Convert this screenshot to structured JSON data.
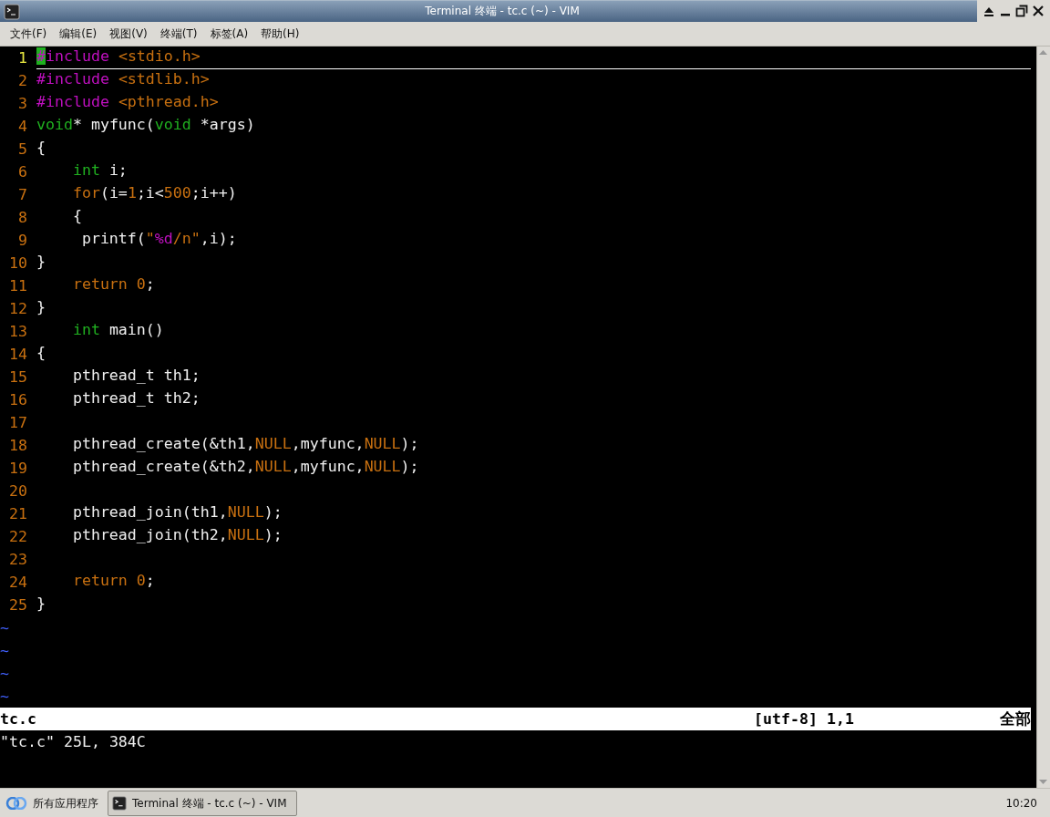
{
  "window": {
    "title": "Terminal 终端 - tc.c (~) - VIM"
  },
  "menu": [
    "文件(F)",
    "编辑(E)",
    "视图(V)",
    "终端(T)",
    "标签(A)",
    "帮助(H)"
  ],
  "editor": {
    "lines": [
      {
        "number": "1",
        "current": true,
        "tokens": [
          {
            "kind": "cursor",
            "text": "#"
          },
          {
            "kind": "preproc",
            "text": "include "
          },
          {
            "kind": "constant",
            "text": "<stdio.h>"
          }
        ]
      },
      {
        "number": "2",
        "current": false,
        "tokens": [
          {
            "kind": "preproc",
            "text": "#include "
          },
          {
            "kind": "constant",
            "text": "<stdlib.h>"
          }
        ]
      },
      {
        "number": "3",
        "current": false,
        "tokens": [
          {
            "kind": "preproc",
            "text": "#include "
          },
          {
            "kind": "constant",
            "text": "<pthread.h>"
          }
        ]
      },
      {
        "number": "4",
        "current": false,
        "tokens": [
          {
            "kind": "type",
            "text": "void"
          },
          {
            "kind": "plain",
            "text": "* myfunc("
          },
          {
            "kind": "type",
            "text": "void"
          },
          {
            "kind": "plain",
            "text": " *args)"
          }
        ]
      },
      {
        "number": "5",
        "current": false,
        "tokens": [
          {
            "kind": "plain",
            "text": "{"
          }
        ]
      },
      {
        "number": "6",
        "current": false,
        "indented": true,
        "tokens": [
          {
            "kind": "type",
            "text": "int"
          },
          {
            "kind": "plain",
            "text": " i;"
          }
        ]
      },
      {
        "number": "7",
        "current": false,
        "indented": true,
        "tokens": [
          {
            "kind": "constant",
            "text": "for"
          },
          {
            "kind": "plain",
            "text": "(i="
          },
          {
            "kind": "constant",
            "text": "1"
          },
          {
            "kind": "plain",
            "text": ";i<"
          },
          {
            "kind": "constant",
            "text": "500"
          },
          {
            "kind": "plain",
            "text": ";i++)"
          }
        ]
      },
      {
        "number": "8",
        "current": false,
        "indented": true,
        "tokens": [
          {
            "kind": "plain",
            "text": "{"
          }
        ]
      },
      {
        "number": "9",
        "current": false,
        "indented": true,
        "tokens": [
          {
            "kind": "plain",
            "text": " printf("
          },
          {
            "kind": "constant",
            "text": "\""
          },
          {
            "kind": "preproc",
            "text": "%d"
          },
          {
            "kind": "constant",
            "text": "/n\""
          },
          {
            "kind": "plain",
            "text": ",i);"
          }
        ]
      },
      {
        "number": "10",
        "current": false,
        "tokens": [
          {
            "kind": "plain",
            "text": "}"
          }
        ]
      },
      {
        "number": "11",
        "current": false,
        "indented": true,
        "tokens": [
          {
            "kind": "constant",
            "text": "return 0"
          },
          {
            "kind": "plain",
            "text": ";"
          }
        ]
      },
      {
        "number": "12",
        "current": false,
        "tokens": [
          {
            "kind": "plain",
            "text": "}"
          }
        ]
      },
      {
        "number": "13",
        "current": false,
        "indented": true,
        "tokens": [
          {
            "kind": "type",
            "text": "int"
          },
          {
            "kind": "plain",
            "text": " main()"
          }
        ]
      },
      {
        "number": "14",
        "current": false,
        "tokens": [
          {
            "kind": "plain",
            "text": "{"
          }
        ]
      },
      {
        "number": "15",
        "current": false,
        "indented": true,
        "tokens": [
          {
            "kind": "plain",
            "text": "pthread_t th1;"
          }
        ]
      },
      {
        "number": "16",
        "current": false,
        "indented": true,
        "tokens": [
          {
            "kind": "plain",
            "text": "pthread_t th2;"
          }
        ]
      },
      {
        "number": "17",
        "current": false
      },
      {
        "number": "18",
        "current": false,
        "indented": true,
        "tokens": [
          {
            "kind": "plain",
            "text": "pthread_create(&th1,"
          },
          {
            "kind": "constant",
            "text": "NULL"
          },
          {
            "kind": "plain",
            "text": ",myfunc,"
          },
          {
            "kind": "constant",
            "text": "NULL"
          },
          {
            "kind": "plain",
            "text": ");"
          }
        ]
      },
      {
        "number": "19",
        "current": false,
        "indented": true,
        "tokens": [
          {
            "kind": "plain",
            "text": "pthread_create(&th2,"
          },
          {
            "kind": "constant",
            "text": "NULL"
          },
          {
            "kind": "plain",
            "text": ",myfunc,"
          },
          {
            "kind": "constant",
            "text": "NULL"
          },
          {
            "kind": "plain",
            "text": ");"
          }
        ]
      },
      {
        "number": "20",
        "current": false
      },
      {
        "number": "21",
        "current": false,
        "indented": true,
        "tokens": [
          {
            "kind": "plain",
            "text": "pthread_join(th1,"
          },
          {
            "kind": "constant",
            "text": "NULL"
          },
          {
            "kind": "plain",
            "text": ");"
          }
        ]
      },
      {
        "number": "22",
        "current": false,
        "indented": true,
        "tokens": [
          {
            "kind": "plain",
            "text": "pthread_join(th2,"
          },
          {
            "kind": "constant",
            "text": "NULL"
          },
          {
            "kind": "plain",
            "text": ");"
          }
        ]
      },
      {
        "number": "23",
        "current": false
      },
      {
        "number": "24",
        "current": false,
        "indented": true,
        "tokens": [
          {
            "kind": "constant",
            "text": "return 0"
          },
          {
            "kind": "plain",
            "text": ";"
          }
        ]
      },
      {
        "number": "25",
        "current": false,
        "tokens": [
          {
            "kind": "plain",
            "text": "}"
          }
        ]
      }
    ],
    "filler": [
      "~",
      "~",
      "~",
      "~"
    ],
    "status_line": {
      "file": "tc.c",
      "position": "[utf-8] 1,1",
      "scroll": "全部"
    },
    "message": "\"tc.c\" 25L, 384C"
  },
  "taskbar": {
    "start": "所有应用程序",
    "tasks": [
      {
        "label": "Terminal 终端 - tc.c (~) - VIM",
        "selected": true
      }
    ],
    "clock": "10:20"
  }
}
